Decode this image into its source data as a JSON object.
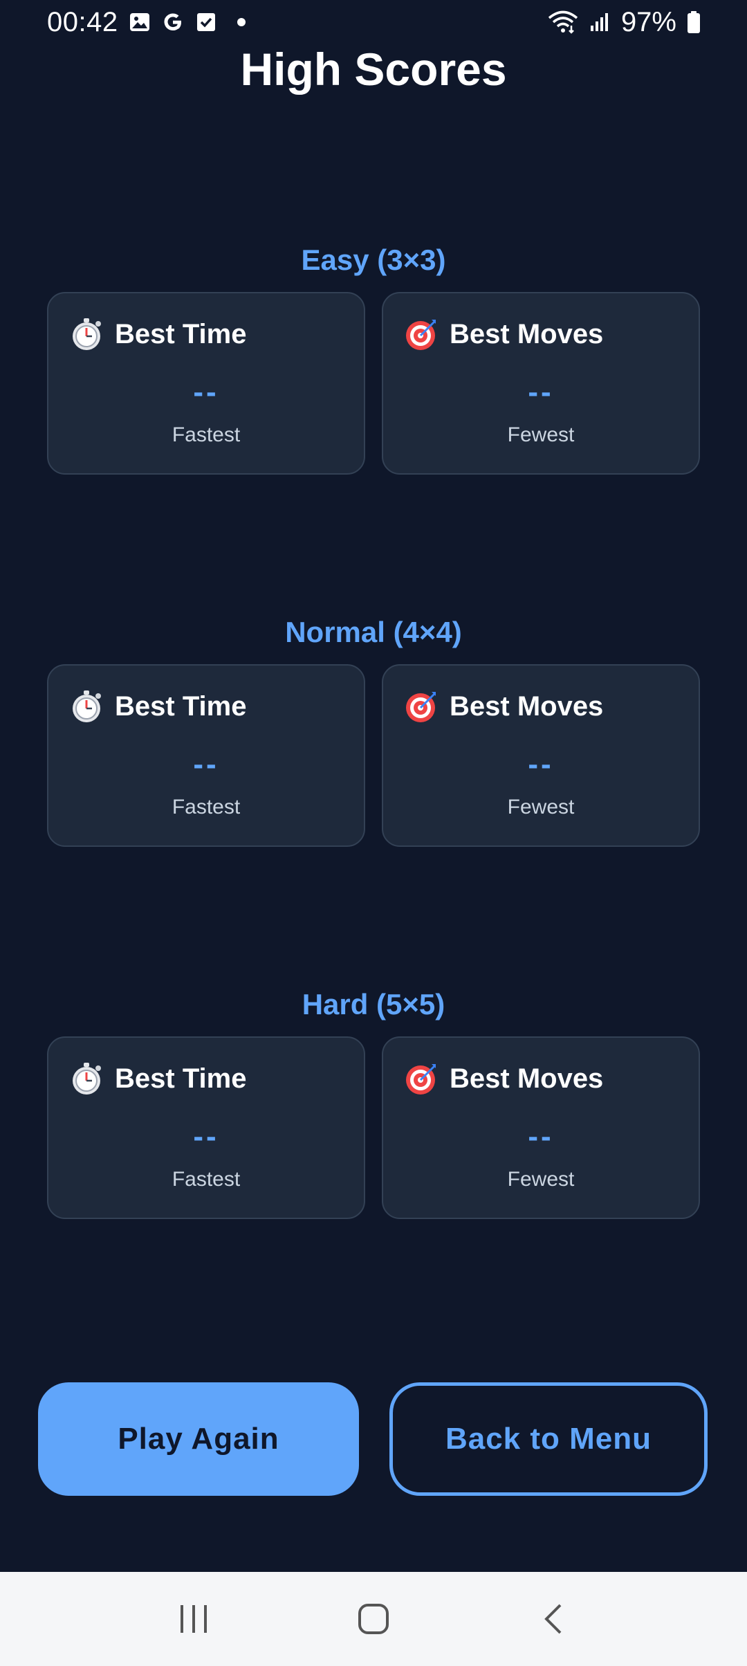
{
  "status_bar": {
    "time": "00:42",
    "battery": "97%",
    "left_icons": [
      "image-icon",
      "google-icon",
      "check-box-icon",
      "dot-icon"
    ],
    "right_icons": [
      "wifi-icon",
      "signal-icon",
      "battery-icon"
    ]
  },
  "page": {
    "title": "High Scores"
  },
  "sections": [
    {
      "title": "Easy (3×3)",
      "cards": [
        {
          "icon": "stopwatch-icon",
          "title": "Best Time",
          "value": "--",
          "subtitle": "Fastest"
        },
        {
          "icon": "target-icon",
          "title": "Best Moves",
          "value": "--",
          "subtitle": "Fewest"
        }
      ]
    },
    {
      "title": "Normal (4×4)",
      "cards": [
        {
          "icon": "stopwatch-icon",
          "title": "Best Time",
          "value": "--",
          "subtitle": "Fastest"
        },
        {
          "icon": "target-icon",
          "title": "Best Moves",
          "value": "--",
          "subtitle": "Fewest"
        }
      ]
    },
    {
      "title": "Hard (5×5)",
      "cards": [
        {
          "icon": "stopwatch-icon",
          "title": "Best Time",
          "value": "--",
          "subtitle": "Fastest"
        },
        {
          "icon": "target-icon",
          "title": "Best Moves",
          "value": "--",
          "subtitle": "Fewest"
        }
      ]
    }
  ],
  "buttons": {
    "play_again": "Play Again",
    "back_to_menu": "Back to Menu"
  },
  "nav_bar": {
    "icons": [
      "recent-apps-icon",
      "home-icon",
      "back-icon"
    ]
  },
  "colors": {
    "background": "#0f172a",
    "card": "#1e293b",
    "accent": "#60a5fa"
  }
}
